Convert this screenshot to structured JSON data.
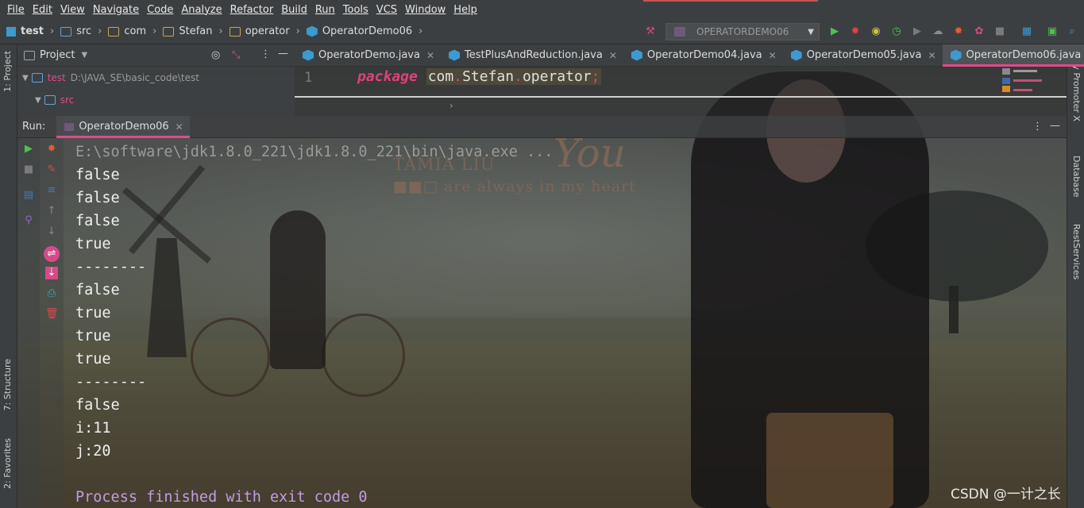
{
  "menu": [
    "File",
    "Edit",
    "View",
    "Navigate",
    "Code",
    "Analyze",
    "Refactor",
    "Build",
    "Run",
    "Tools",
    "VCS",
    "Window",
    "Help"
  ],
  "breadcrumbs": [
    "test",
    "src",
    "com",
    "Stefan",
    "operator",
    "OperatorDemo06"
  ],
  "run_config": "OPERATORDEMO06",
  "left_tabs": {
    "project": "1: Project",
    "structure": "7: Structure",
    "favorites": "2: Favorites"
  },
  "right_tabs": {
    "key_promoter": "Key Promoter X",
    "database": "Database",
    "rest": "RestServices"
  },
  "project_panel": {
    "title": "Project",
    "tree": [
      {
        "name": "test",
        "path": "D:\\JAVA_SE\\basic_code\\test"
      },
      {
        "name": "src",
        "path": ""
      }
    ]
  },
  "editor": {
    "tabs": [
      {
        "label": "OperatorDemo.java",
        "active": false
      },
      {
        "label": "TestPlusAndReduction.java",
        "active": false
      },
      {
        "label": "OperatorDemo04.java",
        "active": false
      },
      {
        "label": "OperatorDemo05.java",
        "active": false
      },
      {
        "label": "OperatorDemo06.java",
        "active": true
      }
    ],
    "line_number": "1",
    "code": {
      "keyword": "package",
      "p1": "com",
      "p2": "Stefan",
      "p3": "operator",
      "end": ";"
    },
    "fold_caret": "›"
  },
  "run": {
    "label": "Run:",
    "tab": "OperatorDemo06",
    "console": [
      {
        "text": "E:\\software\\jdk1.8.0_221\\jdk1.8.0_221\\bin\\java.exe ...",
        "kind": "cmd"
      },
      {
        "text": "false",
        "kind": "out"
      },
      {
        "text": "false",
        "kind": "out"
      },
      {
        "text": "false",
        "kind": "out"
      },
      {
        "text": "true",
        "kind": "out"
      },
      {
        "text": "--------",
        "kind": "out"
      },
      {
        "text": "false",
        "kind": "out"
      },
      {
        "text": "true",
        "kind": "out"
      },
      {
        "text": "true",
        "kind": "out"
      },
      {
        "text": "true",
        "kind": "out"
      },
      {
        "text": "--------",
        "kind": "out"
      },
      {
        "text": "false",
        "kind": "out"
      },
      {
        "text": "i:11",
        "kind": "out"
      },
      {
        "text": "j:20",
        "kind": "out"
      },
      {
        "text": "",
        "kind": "out"
      },
      {
        "text": "Process finished with exit code 0",
        "kind": "exit"
      }
    ]
  },
  "wallpaper": {
    "brand": "TAMIA LIU",
    "brand_big": "You",
    "brand_sub": "are always in my heart"
  },
  "watermark": "CSDN @一计之长",
  "colors": {
    "accent": "#e04a8a",
    "keyword": "#e0407b",
    "exit": "#c39be0",
    "run_green": "#4fc14f"
  }
}
